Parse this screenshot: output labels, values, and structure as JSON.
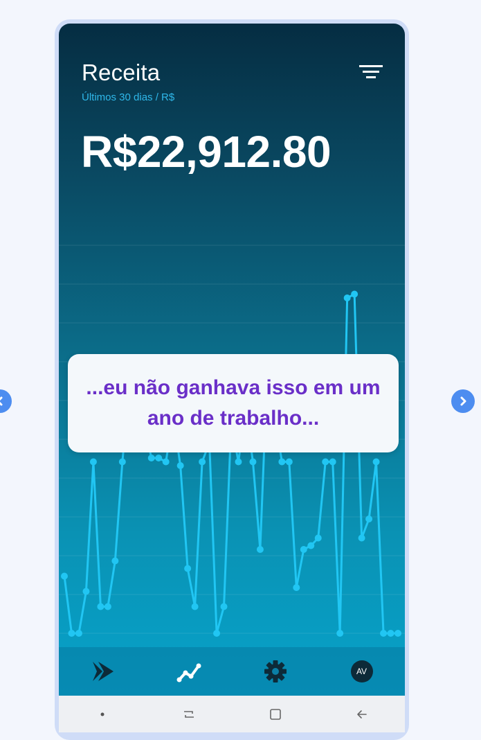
{
  "header": {
    "title": "Receita",
    "subtitle": "Últimos 30 dias / R$",
    "filter_icon": "filter-icon"
  },
  "summary": {
    "total": "R$22,912.80"
  },
  "caption": {
    "text": "...eu não ganhava isso em um ano de trabalho..."
  },
  "tabs": [
    {
      "icon": "play-icon"
    },
    {
      "icon": "trend-line-icon"
    },
    {
      "icon": "gear-icon"
    },
    {
      "icon": "avatar",
      "label": "AV"
    }
  ],
  "android_nav": [
    {
      "icon": "dot-icon"
    },
    {
      "icon": "recent-apps-icon"
    },
    {
      "icon": "home-icon"
    },
    {
      "icon": "back-icon"
    }
  ],
  "carousel": {
    "prev_icon": "chevron-left-icon",
    "next_icon": "chevron-right-icon"
  },
  "colors": {
    "line": "#21c6f3",
    "caption_text": "#6a2fc8",
    "subtitle": "#2fb8ea",
    "accent_arrow": "#4d8df0"
  },
  "chart_data": {
    "type": "line",
    "title": "",
    "xlabel": "",
    "ylabel": "",
    "x": [
      1,
      2,
      3,
      4,
      5,
      6,
      7,
      8,
      9,
      10,
      11,
      12,
      13,
      14,
      15,
      16,
      17,
      18,
      19,
      20,
      21,
      22,
      23,
      24,
      25,
      26,
      27,
      28,
      29,
      30,
      31,
      32,
      33,
      34,
      35,
      36,
      37,
      38,
      39,
      40,
      41,
      42,
      43,
      44,
      45,
      46,
      47
    ],
    "series": [
      {
        "values": [
          15,
          0,
          0,
          11,
          45,
          7,
          7,
          19,
          45,
          66,
          66,
          55,
          46,
          46,
          45,
          57,
          44,
          17,
          7,
          45,
          50,
          0,
          7,
          55,
          45,
          59,
          45,
          22,
          70,
          57,
          45,
          45,
          12,
          22,
          23,
          25,
          45,
          45,
          0,
          88,
          89,
          25,
          30,
          45,
          0,
          0,
          0
        ]
      }
    ],
    "ylim": [
      0,
      100
    ],
    "grid": true
  }
}
